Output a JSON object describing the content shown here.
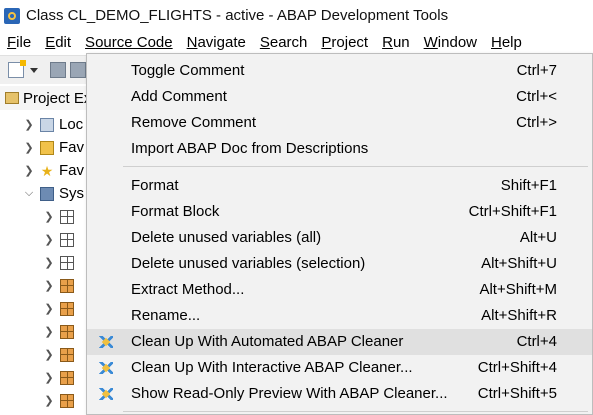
{
  "window": {
    "title": "Class CL_DEMO_FLIGHTS  - active - ABAP Development Tools",
    "icon": "abap-dev-tools-icon"
  },
  "menubar": {
    "items": [
      {
        "mnemonic": "F",
        "rest": "ile"
      },
      {
        "mnemonic": "E",
        "rest": "dit"
      },
      {
        "mnemonic": "S",
        "rest": "ource Code"
      },
      {
        "mnemonic": "N",
        "rest": "avigate"
      },
      {
        "mnemonic": "S",
        "rest": "earch"
      },
      {
        "mnemonic": "P",
        "rest": "roject"
      },
      {
        "mnemonic": "R",
        "rest": "un"
      },
      {
        "mnemonic": "W",
        "rest": "indow"
      },
      {
        "mnemonic": "H",
        "rest": "elp"
      }
    ]
  },
  "project_explorer": {
    "title": "Project Ex",
    "rows": [
      {
        "label": "Loc",
        "icon": "local-objects-icon"
      },
      {
        "label": "Fav",
        "icon": "favorite-packages-icon"
      },
      {
        "label": "Fav",
        "icon": "favorite-star-icon"
      },
      {
        "label": "Sys",
        "icon": "system-library-icon"
      },
      {
        "label": "",
        "icon": "package-icon"
      },
      {
        "label": "",
        "icon": "package-icon"
      },
      {
        "label": "",
        "icon": "package-icon"
      },
      {
        "label": "",
        "icon": "package-orange-icon"
      },
      {
        "label": "",
        "icon": "package-orange-icon"
      },
      {
        "label": "",
        "icon": "package-orange-icon"
      },
      {
        "label": "",
        "icon": "package-orange-icon"
      },
      {
        "label": "",
        "icon": "package-orange-icon"
      },
      {
        "label": "",
        "icon": "package-orange-icon"
      }
    ]
  },
  "source_code_menu": {
    "items": [
      {
        "label": "Toggle Comment",
        "shortcut": "Ctrl+7"
      },
      {
        "label": "Add Comment",
        "shortcut": "Ctrl+<"
      },
      {
        "label": "Remove Comment",
        "shortcut": "Ctrl+>"
      },
      {
        "label": "Import ABAP Doc from Descriptions",
        "shortcut": ""
      },
      {
        "label": "Format",
        "shortcut": "Shift+F1"
      },
      {
        "label": "Format Block",
        "shortcut": "Ctrl+Shift+F1"
      },
      {
        "label": "Delete unused variables (all)",
        "shortcut": "Alt+U"
      },
      {
        "label": "Delete unused variables (selection)",
        "shortcut": "Alt+Shift+U"
      },
      {
        "label": "Extract Method...",
        "shortcut": "Alt+Shift+M"
      },
      {
        "label": "Rename...",
        "shortcut": "Alt+Shift+R"
      },
      {
        "label": "Clean Up With Automated ABAP Cleaner",
        "shortcut": "Ctrl+4",
        "icon": "abap-cleaner-icon"
      },
      {
        "label": "Clean Up With Interactive ABAP Cleaner...",
        "shortcut": "Ctrl+Shift+4",
        "icon": "abap-cleaner-icon"
      },
      {
        "label": "Show Read-Only Preview With ABAP Cleaner...",
        "shortcut": "Ctrl+Shift+5",
        "icon": "abap-cleaner-icon"
      }
    ],
    "highlighted_index": 10
  },
  "colors": {
    "menu_background": "#f2f2f2",
    "highlight": "#e0e0e0",
    "cleaner_icon_blue": "#3a8ad6"
  }
}
